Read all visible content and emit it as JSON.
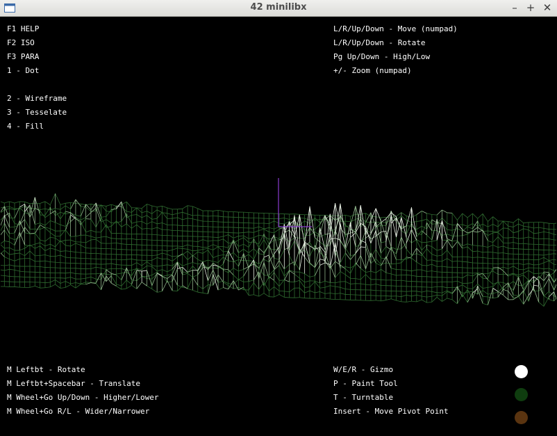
{
  "window": {
    "title": "42 minilibx"
  },
  "help": {
    "top_left": [
      "F1 HELP",
      "F2 ISO",
      "F3 PARA",
      "1 - Dot",
      "2 - Wireframe",
      "3 - Tesselate",
      "4 - Fill"
    ],
    "top_right": [
      "L/R/Up/Down - Move (numpad)",
      "L/R/Up/Down - Rotate",
      "Pg Up/Down - High/Low",
      "+/- Zoom (numpad)"
    ],
    "bottom_left": [
      "M Leftbt - Rotate",
      "M Leftbt+Spacebar - Translate",
      "M Wheel+Go Up/Down - Higher/Lower",
      "M Wheel+Go R/L - Wider/Narrower"
    ],
    "bottom_right": [
      "W/E/R - Gizmo",
      "P - Paint Tool",
      "T - Turntable",
      "Insert - Move Pivot Point"
    ]
  },
  "palette": {
    "colors": [
      "#ffffff",
      "#0f3d0f",
      "#5a3410"
    ]
  },
  "colors": {
    "wireframe_low": "#2f6b30",
    "wireframe_high": "#e8f0e4",
    "gizmo": "#8a3ccf",
    "text": "#ffffff",
    "background": "#000000"
  }
}
